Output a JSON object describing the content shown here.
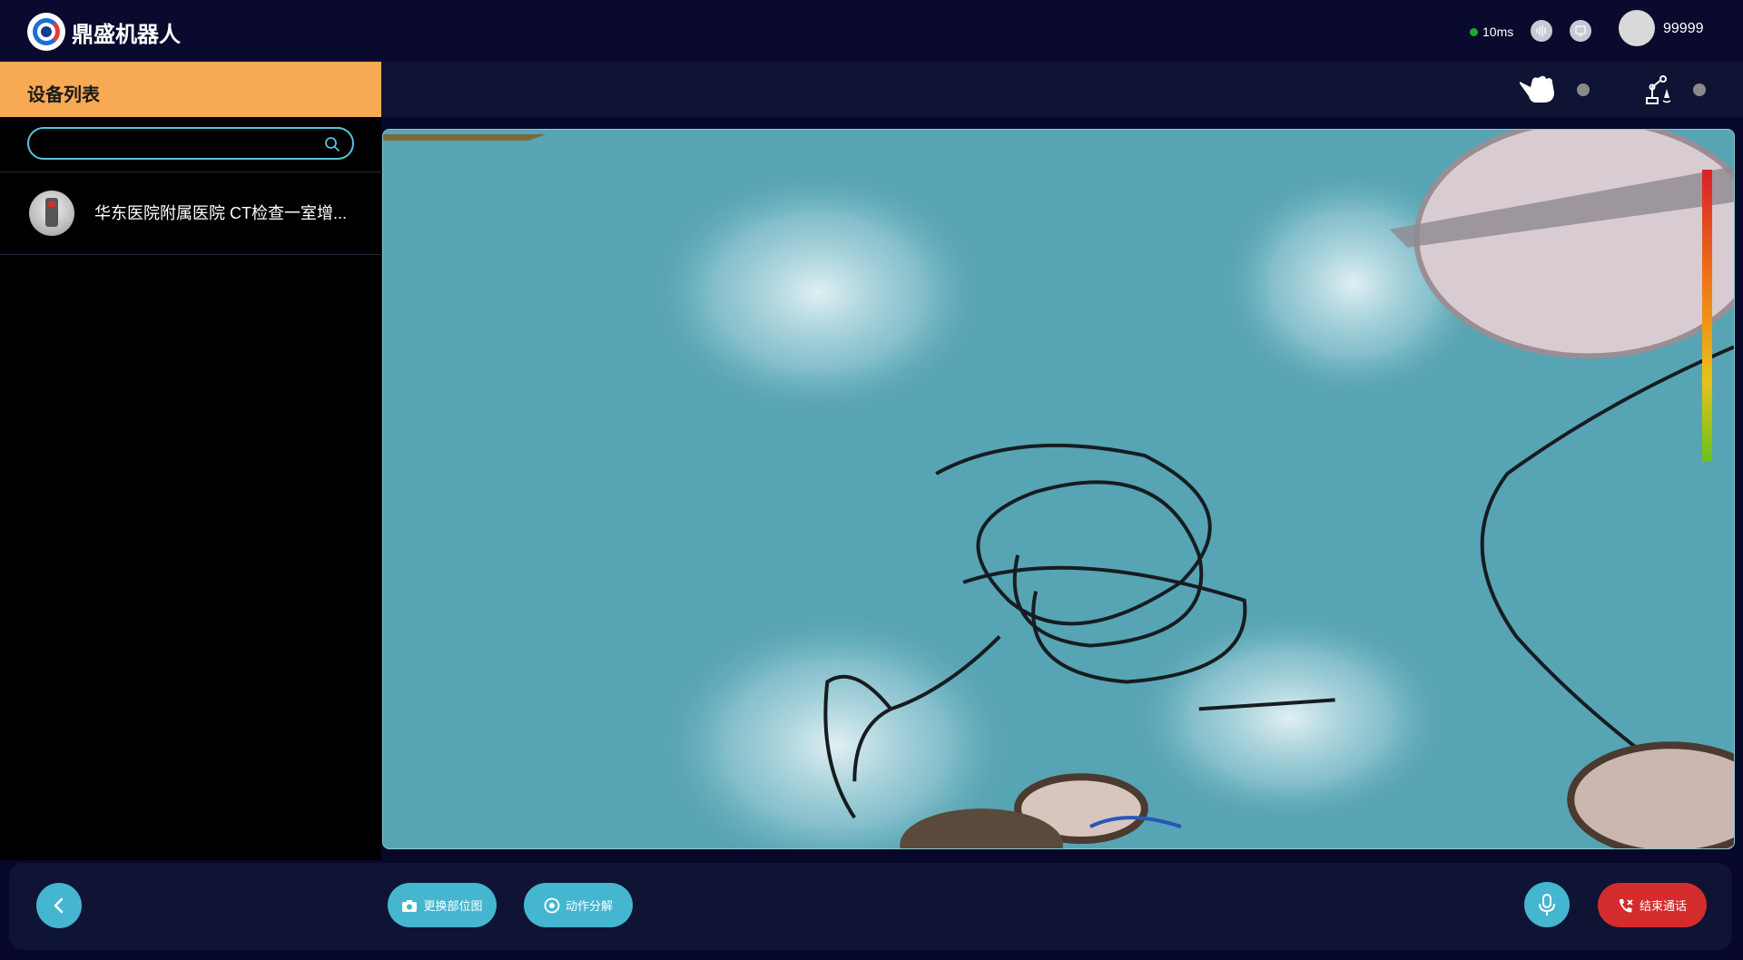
{
  "app": {
    "brand": "鼎盛机器人",
    "latency": "10ms",
    "username": "99999"
  },
  "colors": {
    "accent_orange": "#f8a954",
    "accent_cyan": "#45b6cf",
    "danger_red": "#d42c2c",
    "status_green": "#1aa92a",
    "background": "#07072a"
  },
  "topbar_icons": [
    "logo-icon",
    "audio-wave-icon",
    "screen-share-icon",
    "avatar"
  ],
  "sidebar": {
    "title": "设备列表",
    "search": {
      "value": "",
      "placeholder": ""
    },
    "devices": [
      {
        "name": "华东医院附属医院 CT检查一室增...",
        "thumbnail": "robot-thumbnail"
      }
    ]
  },
  "main_header": {
    "indicators": [
      {
        "icon": "hand-control-icon",
        "state": "inactive"
      },
      {
        "icon": "robot-arm-icon",
        "state": "inactive"
      }
    ]
  },
  "video": {
    "description": "camera-feed",
    "level_meter": "audio-level-meter"
  },
  "bottom_bar": {
    "back": "back-icon",
    "buttons": [
      {
        "label": "更换部位图",
        "icon": "camera-icon"
      },
      {
        "label": "动作分解",
        "icon": "target-icon"
      }
    ],
    "mic": "microphone-icon",
    "end_call": {
      "label": "结束通话",
      "icon": "phone-hangup-icon"
    }
  }
}
